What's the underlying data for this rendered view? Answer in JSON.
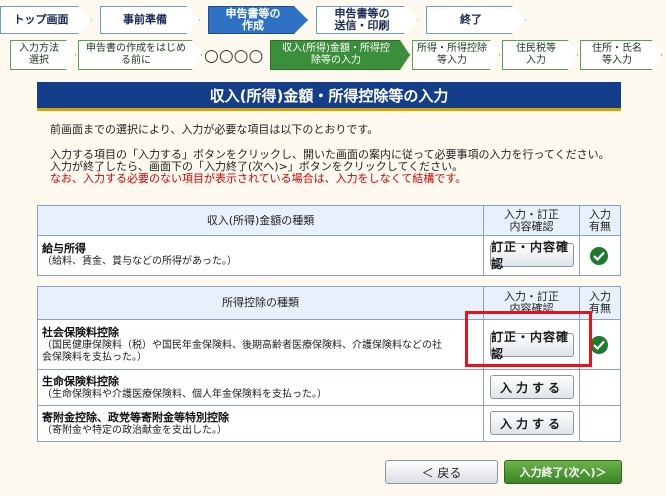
{
  "steps": [
    {
      "label": "トップ画面",
      "active": false
    },
    {
      "label": "事前準備",
      "active": false
    },
    {
      "label": "申告書等の作成",
      "line1": "申告書等の",
      "line2": "作成",
      "active": true
    },
    {
      "label": "申告書等の送信・印刷",
      "line1": "申告書等の",
      "line2": "送信・印刷",
      "active": false
    },
    {
      "label": "終了",
      "active": false
    }
  ],
  "substeps": [
    {
      "line1": "入力方法",
      "line2": "選択"
    },
    {
      "line1": "申告書の作成をはじめ",
      "line2": "る前に"
    },
    {
      "line1": "収入(所得)金額・所得控",
      "line2": "除等の入力",
      "active": true
    },
    {
      "line1": "所得・所得控除",
      "line2": "等入力"
    },
    {
      "line1": "住民税等",
      "line2": "入力"
    },
    {
      "line1": "住所・氏名",
      "line2": "等入力"
    }
  ],
  "substep_circles": "○○○○",
  "page_title": "収入(所得)金額・所得控除等の入力",
  "instructions": {
    "line1": "前画面までの選択により、入力が必要な項目は以下のとおりです。",
    "line2": "入力する項目の「入力する」ボタンをクリックし、開いた画面の案内に従って必要事項の入力を行ってください。",
    "line3": "入力が終了したら、画面下の「入力終了(次へ)>」ボタンをクリックしてください。",
    "line4_red": "なお、入力する必要のない項目が表示されている場合は、入力をしなくて結構です。"
  },
  "income_table": {
    "header_kind": "収入(所得)金額の種類",
    "header_action_line1": "入力・訂正",
    "header_action_line2": "内容確認",
    "header_status_line1": "入力",
    "header_status_line2": "有無",
    "rows": [
      {
        "title": "給与所得",
        "desc": "（給料、賃金、賞与などの所得があった。）",
        "button": "訂正・内容確認",
        "entered": true
      }
    ]
  },
  "deduction_table": {
    "header_kind": "所得控除の種類",
    "header_action_line1": "入力・訂正",
    "header_action_line2": "内容確認",
    "header_status_line1": "入力",
    "header_status_line2": "有無",
    "rows": [
      {
        "title": "社会保険料控除",
        "desc1": "（国民健康保険料（税）や国民年金保険料、後期高齢者医療保険料、介護保険料などの社",
        "desc2": "会保険料を支払った。）",
        "button": "訂正・内容確認",
        "entered": true
      },
      {
        "title": "生命保険料控除",
        "desc1": "（生命保険料や介護医療保険料、個人年金保険料を支払った。）",
        "button": "入力する",
        "entered": false
      },
      {
        "title": "寄附金控除、政党等寄附金等特別控除",
        "desc1": "（寄附金や特定の政治献金を支出した。）",
        "button": "入力する",
        "entered": false
      }
    ]
  },
  "footer": {
    "back_label": "＜ 戻る",
    "next_label": "入力終了(次へ)＞"
  },
  "colors": {
    "title_band": "#143e8a",
    "highlight": "#e8121c",
    "check": "#1f7a2e",
    "next_button": "#3a8526"
  }
}
